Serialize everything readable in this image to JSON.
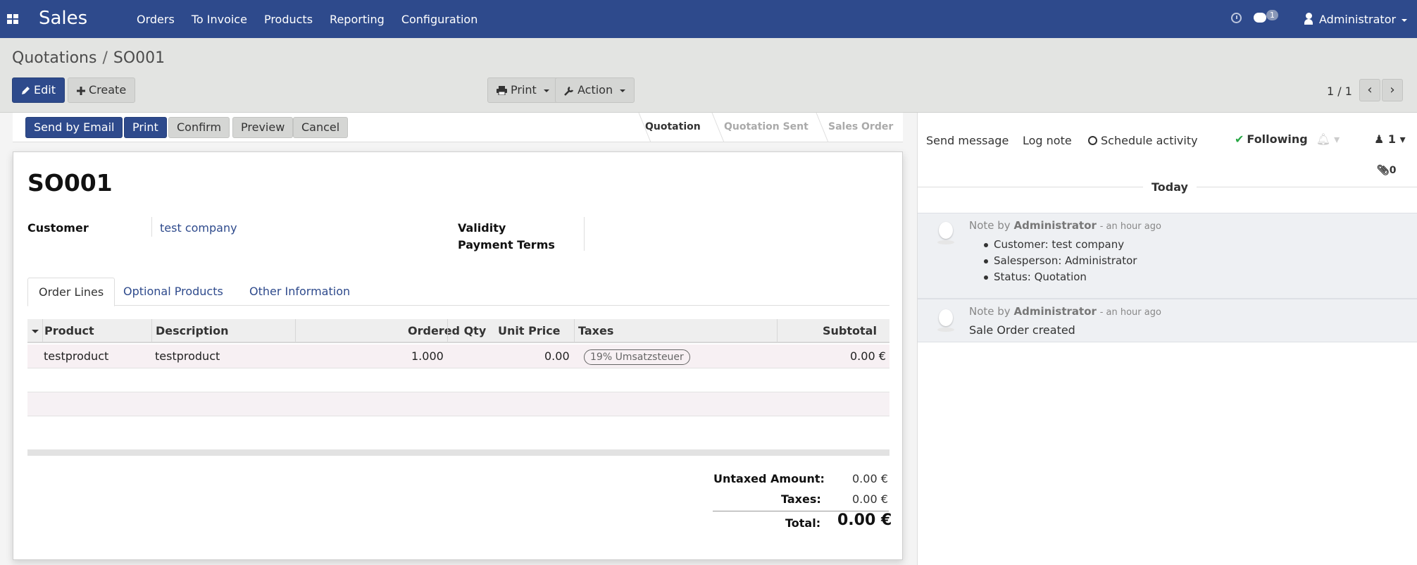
{
  "navbar": {
    "app_name": "Sales",
    "menu": [
      "Orders",
      "To Invoice",
      "Products",
      "Reporting",
      "Configuration"
    ],
    "chat_badge": "1",
    "user": "Administrator"
  },
  "control_panel": {
    "breadcrumb_parent": "Quotations",
    "breadcrumb_separator": "/",
    "breadcrumb_current": "SO001",
    "edit_label": "Edit",
    "create_label": "Create",
    "print_label": "Print",
    "action_label": "Action",
    "pager": "1 / 1"
  },
  "statusbar": {
    "buttons": [
      "Send by Email",
      "Print",
      "Confirm",
      "Preview",
      "Cancel"
    ],
    "stages": [
      "Quotation",
      "Quotation Sent",
      "Sales Order"
    ],
    "active_stage": "Quotation"
  },
  "form": {
    "title": "SO001",
    "customer_label": "Customer",
    "customer_value": "test company",
    "validity_label": "Validity",
    "payment_terms_label": "Payment Terms",
    "tabs": [
      "Order Lines",
      "Optional Products",
      "Other Information"
    ],
    "columns": [
      "Product",
      "Description",
      "Ordered Qty",
      "Unit Price",
      "Taxes",
      "Subtotal"
    ],
    "rows": [
      {
        "product": "testproduct",
        "description": "testproduct",
        "qty": "1.000",
        "unit_price": "0.00",
        "tax": "19% Umsatzsteuer",
        "subtotal": "0.00 €"
      }
    ],
    "totals": {
      "untaxed_label": "Untaxed Amount:",
      "untaxed_value": "0.00 €",
      "taxes_label": "Taxes:",
      "taxes_value": "0.00 €",
      "total_label": "Total:",
      "total_value": "0.00 €"
    }
  },
  "chatter": {
    "send_message": "Send message",
    "log_note": "Log note",
    "schedule_activity": "Schedule activity",
    "following": "Following",
    "followers_count": "1",
    "attachments_count": "0",
    "date_separator": "Today",
    "messages": [
      {
        "prefix": "Note by",
        "author": "Administrator",
        "time": "- an hour ago",
        "items": [
          "Customer: test company",
          "Salesperson: Administrator",
          "Status: Quotation"
        ]
      },
      {
        "prefix": "Note by",
        "author": "Administrator",
        "time": "- an hour ago",
        "body": "Sale Order created"
      }
    ]
  },
  "colors": {
    "brand": "#2e4a8c",
    "control_panel_bg": "#e3e4e2",
    "check_green": "#28a745"
  }
}
